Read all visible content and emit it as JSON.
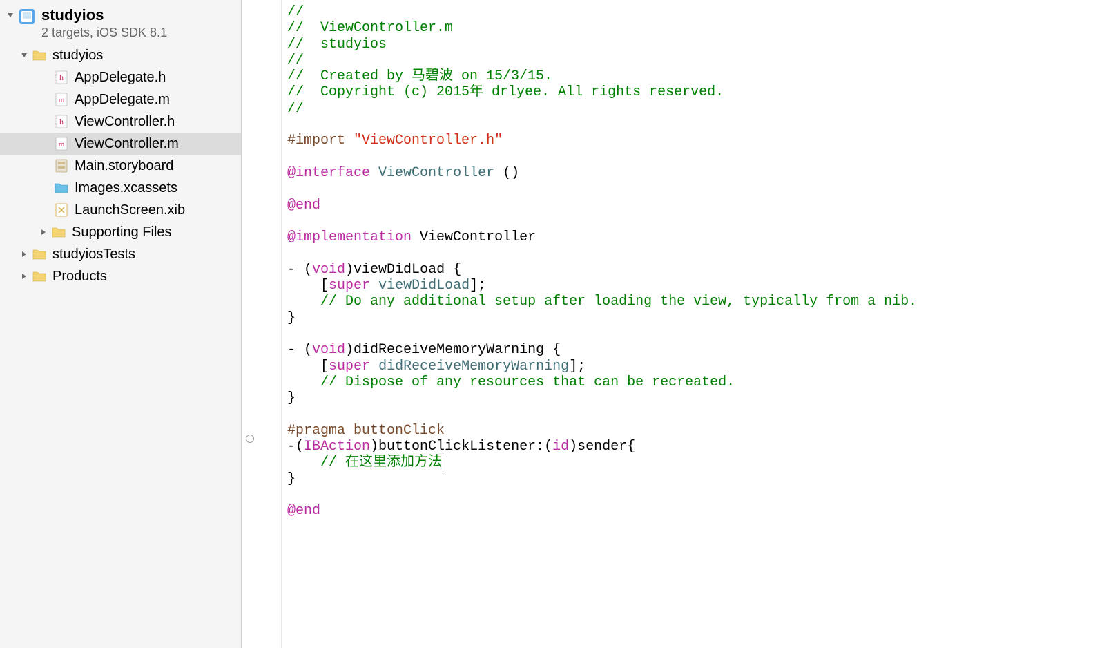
{
  "sidebar": {
    "project": {
      "name": "studyios",
      "subtitle": "2 targets, iOS SDK 8.1"
    },
    "tree": [
      {
        "label": "studyios",
        "type": "folder",
        "indent": 1,
        "disclosure": "open"
      },
      {
        "label": "AppDelegate.h",
        "type": "h",
        "indent": 2
      },
      {
        "label": "AppDelegate.m",
        "type": "m",
        "indent": 2
      },
      {
        "label": "ViewController.h",
        "type": "h",
        "indent": 2
      },
      {
        "label": "ViewController.m",
        "type": "m",
        "indent": 2,
        "selected": true
      },
      {
        "label": "Main.storyboard",
        "type": "storyboard",
        "indent": 2
      },
      {
        "label": "Images.xcassets",
        "type": "xcassets",
        "indent": 2
      },
      {
        "label": "LaunchScreen.xib",
        "type": "xib",
        "indent": 2
      },
      {
        "label": "Supporting Files",
        "type": "folder",
        "indent": 2,
        "disclosure": "closed"
      },
      {
        "label": "studyiosTests",
        "type": "folder",
        "indent": 1,
        "disclosure": "closed"
      },
      {
        "label": "Products",
        "type": "folder",
        "indent": 1,
        "disclosure": "closed"
      }
    ]
  },
  "code": {
    "comment_lines": [
      "//",
      "//  ViewController.m",
      "//  studyios",
      "//",
      "//  Created by 马碧波 on 15/3/15.",
      "//  Copyright (c) 2015年 drlyee. All rights reserved.",
      "//"
    ],
    "import_kw": "#import",
    "import_str": "\"ViewController.h\"",
    "interface_kw": "@interface",
    "class_name": "ViewController",
    "paren": "()",
    "end_kw": "@end",
    "impl_kw": "@implementation",
    "void_kw": "void",
    "viewDidLoad": "viewDidLoad",
    "super_kw": "super",
    "setup_comment": "// Do any additional setup after loading the view, typically from a nib.",
    "didReceive": "didReceiveMemoryWarning",
    "dispose_comment": "// Dispose of any resources that can be recreated.",
    "pragma": "#pragma",
    "pragma_label": "buttonClick",
    "ibaction": "IBAction",
    "buttonClick": "buttonClickListener:",
    "id_kw": "id",
    "sender": "sender{",
    "add_method_comment": "// 在这里添加方法",
    "brace_open": "{",
    "brace_close": "}",
    "sig_prefix": "- (",
    "sig_mid": ")",
    "sig_prefix2": "-(",
    "paren_open": "(",
    "paren_close": ")",
    "bracket_open": "[",
    "bracket_close": "];",
    "space4": "    "
  }
}
